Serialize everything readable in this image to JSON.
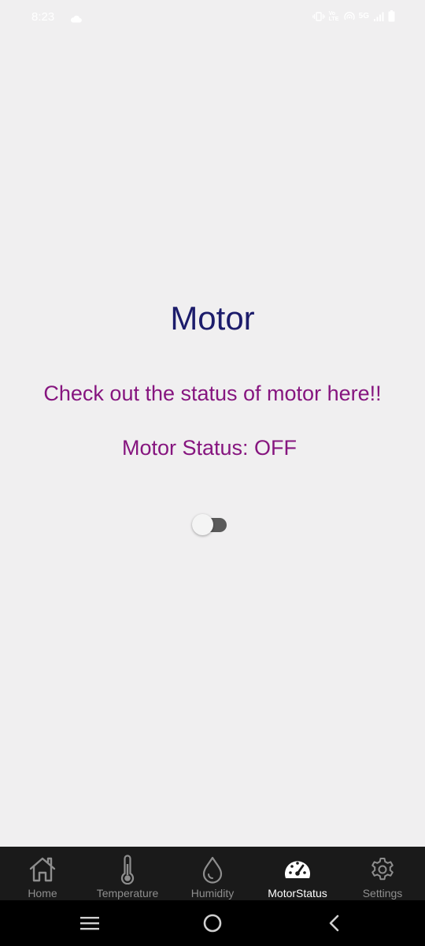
{
  "status_bar": {
    "time": "8:23",
    "network": "5G",
    "volte": "Vo LTE"
  },
  "main": {
    "title": "Motor",
    "subtitle": "Check out the status of motor here!!",
    "motor_status": "Motor Status: OFF",
    "toggle_on": false
  },
  "bottom_nav": {
    "items": [
      {
        "label": "Home",
        "icon": "home-icon",
        "active": false
      },
      {
        "label": "Temperature",
        "icon": "thermometer-icon",
        "active": false
      },
      {
        "label": "Humidity",
        "icon": "droplet-icon",
        "active": false
      },
      {
        "label": "MotorStatus",
        "icon": "speedometer-icon",
        "active": true
      },
      {
        "label": "Settings",
        "icon": "gear-icon",
        "active": false
      }
    ]
  },
  "colors": {
    "background": "#f0eff0",
    "title": "#1c1c6b",
    "accent_text": "#86157f",
    "nav_bg": "#1a1a1a",
    "nav_active": "#ffffff",
    "nav_inactive": "#8e8e8e"
  }
}
